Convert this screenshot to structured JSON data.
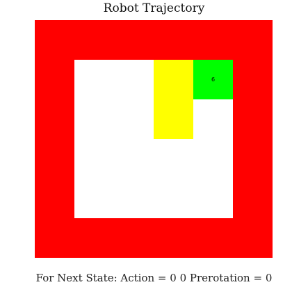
{
  "title": "Robot Trajectory",
  "footer": {
    "text": "For Next State: Action = 0 0 Prerotation = 0"
  },
  "grid": {
    "rows": 6,
    "cols": 6,
    "legend": {
      "wall": "#ff0000",
      "free": "#ffffff",
      "trajectory": "#ffff00",
      "robot": "#00ff00"
    },
    "cells": [
      [
        "wall",
        "wall",
        "wall",
        "wall",
        "wall",
        "wall"
      ],
      [
        "wall",
        "free",
        "free",
        "trajectory",
        "robot",
        "wall"
      ],
      [
        "wall",
        "free",
        "free",
        "trajectory",
        "free",
        "wall"
      ],
      [
        "wall",
        "free",
        "free",
        "free",
        "free",
        "wall"
      ],
      [
        "wall",
        "free",
        "free",
        "free",
        "free",
        "wall"
      ],
      [
        "wall",
        "wall",
        "wall",
        "wall",
        "wall",
        "wall"
      ]
    ],
    "robot": {
      "row": 1,
      "col": 4,
      "label": "6"
    }
  }
}
